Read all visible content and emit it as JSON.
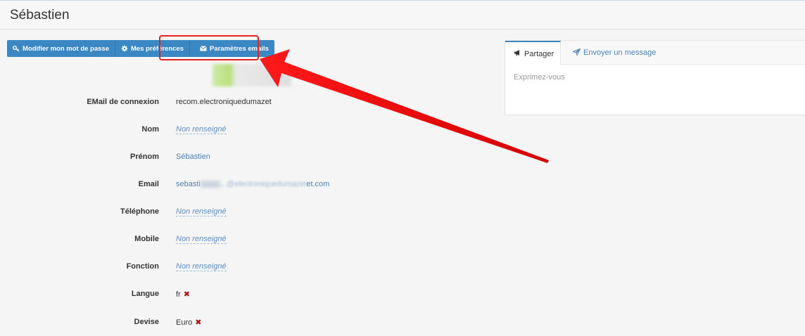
{
  "header": {
    "title": "Sébastien"
  },
  "toolbar": {
    "change_password_label": "Modifier mon mot de passe",
    "preferences_label": "Mes préférences",
    "email_settings_label": "Paramètres emails"
  },
  "profile": {
    "rows": [
      {
        "label": "EMail de connexion",
        "value": "recom.electroniquedumazet"
      },
      {
        "label": "Nom",
        "value": "Non renseigné"
      },
      {
        "label": "Prénom",
        "value": "Sébastien"
      },
      {
        "label": "Email",
        "value_prefix": "sebasti",
        "value_blurred": "...@electroniquedumazet",
        "value_suffix": "et.com"
      },
      {
        "label": "Téléphone",
        "value": "Non renseigné"
      },
      {
        "label": "Mobile",
        "value": "Non renseigné"
      },
      {
        "label": "Fonction",
        "value": "Non renseigné"
      },
      {
        "label": "Langue",
        "value": "fr"
      },
      {
        "label": "Devise",
        "value": "Euro"
      }
    ]
  },
  "panel": {
    "tabs": [
      {
        "label": "Partager",
        "icon": "bullhorn-icon"
      },
      {
        "label": "Envoyer un message",
        "icon": "paper-plane-icon"
      }
    ],
    "placeholder": "Exprimez-vous"
  },
  "icons": {
    "remove": "✖"
  },
  "colors": {
    "primary": "#3a87c4",
    "link": "#4a82b8",
    "highlight": "#e32222",
    "remove": "#b01010"
  }
}
